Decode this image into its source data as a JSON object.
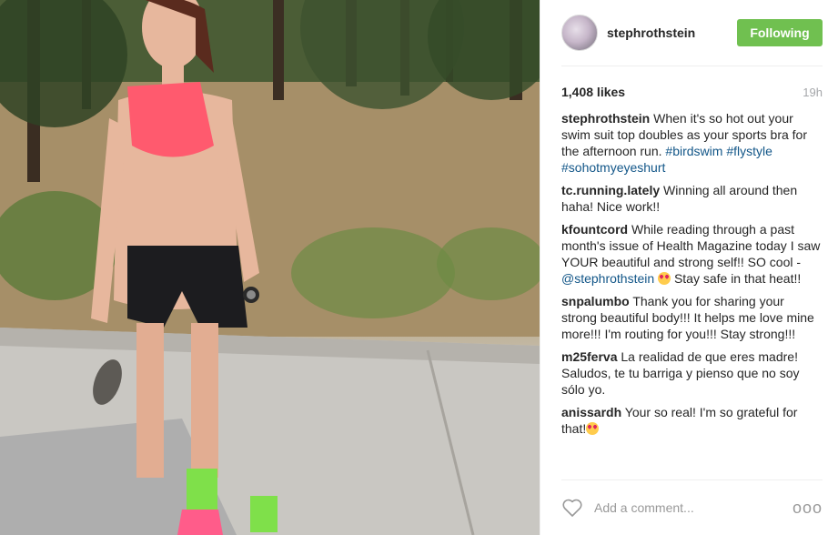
{
  "header": {
    "username": "stephrothstein",
    "follow_label": "Following"
  },
  "stats": {
    "likes": "1,408 likes",
    "time": "19h"
  },
  "caption": {
    "user": "stephrothstein",
    "text": "When it's so hot out your swim suit top doubles as your sports bra for the afternoon run.",
    "hashtags": [
      "#birdswim",
      "#flystyle",
      "#sohotmyeyeshurt"
    ]
  },
  "comments": [
    {
      "user": "tc.running.lately",
      "text": "Winning all around then haha! Nice work!!"
    },
    {
      "user": "kfountcord",
      "text_before": "While reading through a past month's issue of Health Magazine today I saw YOUR beautiful and strong self!! SO cool -",
      "mention": "@stephrothstein",
      "emoji": "heart-eyes-emoji",
      "text_after": "Stay safe in that heat!!"
    },
    {
      "user": "snpalumbo",
      "text": "Thank you for sharing your strong beautiful body!!! It helps me love mine more!!! I'm routing for you!!! Stay strong!!!"
    },
    {
      "user": "m25ferva",
      "text": "La realidad de que eres madre! Saludos, te tu barriga y pienso que no soy sólo yo."
    },
    {
      "user": "anissardh",
      "text": "Your so real! I'm so grateful for that!",
      "emoji": "heart-eyes-emoji"
    }
  ],
  "footer": {
    "comment_placeholder": "Add a comment...",
    "more_label": "ooo"
  },
  "colors": {
    "follow_button": "#70c050",
    "link": "#125688",
    "muted": "#a5a7aa"
  }
}
